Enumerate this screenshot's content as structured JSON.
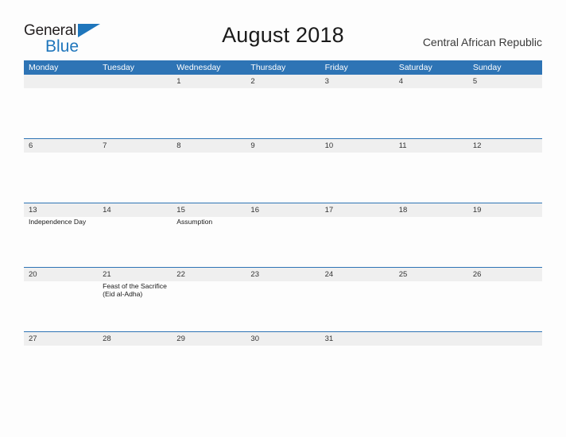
{
  "brand": {
    "name_part1": "General",
    "name_part2": "Blue",
    "triangle_icon": "triangle-icon",
    "blue": "#1f76bc"
  },
  "header": {
    "title": "August 2018",
    "country": "Central African Republic"
  },
  "theme": {
    "header_blue": "#2e74b5",
    "band_gray": "#efefef",
    "page_bg": "#fdfdfd",
    "text": "#333333"
  },
  "calendar": {
    "weekdays": [
      "Monday",
      "Tuesday",
      "Wednesday",
      "Thursday",
      "Friday",
      "Saturday",
      "Sunday"
    ],
    "weeks": [
      [
        {
          "day": "",
          "events": []
        },
        {
          "day": "",
          "events": []
        },
        {
          "day": "1",
          "events": []
        },
        {
          "day": "2",
          "events": []
        },
        {
          "day": "3",
          "events": []
        },
        {
          "day": "4",
          "events": []
        },
        {
          "day": "5",
          "events": []
        }
      ],
      [
        {
          "day": "6",
          "events": []
        },
        {
          "day": "7",
          "events": []
        },
        {
          "day": "8",
          "events": []
        },
        {
          "day": "9",
          "events": []
        },
        {
          "day": "10",
          "events": []
        },
        {
          "day": "11",
          "events": []
        },
        {
          "day": "12",
          "events": []
        }
      ],
      [
        {
          "day": "13",
          "events": [
            "Independence Day"
          ]
        },
        {
          "day": "14",
          "events": []
        },
        {
          "day": "15",
          "events": [
            "Assumption"
          ]
        },
        {
          "day": "16",
          "events": []
        },
        {
          "day": "17",
          "events": []
        },
        {
          "day": "18",
          "events": []
        },
        {
          "day": "19",
          "events": []
        }
      ],
      [
        {
          "day": "20",
          "events": []
        },
        {
          "day": "21",
          "events": [
            "Feast of the Sacrifice (Eid al-Adha)"
          ]
        },
        {
          "day": "22",
          "events": []
        },
        {
          "day": "23",
          "events": []
        },
        {
          "day": "24",
          "events": []
        },
        {
          "day": "25",
          "events": []
        },
        {
          "day": "26",
          "events": []
        }
      ],
      [
        {
          "day": "27",
          "events": []
        },
        {
          "day": "28",
          "events": []
        },
        {
          "day": "29",
          "events": []
        },
        {
          "day": "30",
          "events": []
        },
        {
          "day": "31",
          "events": []
        },
        {
          "day": "",
          "events": []
        },
        {
          "day": "",
          "events": []
        }
      ]
    ]
  }
}
